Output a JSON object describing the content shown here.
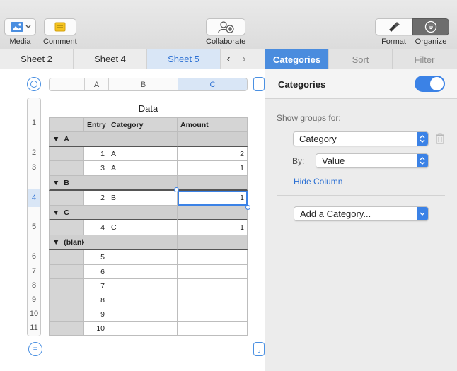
{
  "toolbar": {
    "media_label": "Media",
    "comment_label": "Comment",
    "collaborate_label": "Collaborate",
    "format_label": "Format",
    "organize_label": "Organize"
  },
  "sheet_tabs": [
    "Sheet 2",
    "Sheet 4",
    "Sheet 5"
  ],
  "active_sheet": "Sheet 5",
  "table": {
    "title": "Data",
    "column_letters": [
      "A",
      "B",
      "C"
    ],
    "selected_column": "C",
    "row_numbers": [
      "1",
      "2",
      "3",
      "4",
      "5",
      "6",
      "7",
      "8",
      "9",
      "10",
      "11"
    ],
    "selected_row": "4",
    "headers": [
      "Entry",
      "Category",
      "Amount"
    ],
    "groups": [
      {
        "label": "A",
        "rows": [
          {
            "entry": "1",
            "category": "A",
            "amount": "2"
          },
          {
            "entry": "3",
            "category": "A",
            "amount": "1"
          }
        ]
      },
      {
        "label": "B",
        "rows": [
          {
            "entry": "2",
            "category": "B",
            "amount": "1"
          }
        ]
      },
      {
        "label": "C",
        "rows": [
          {
            "entry": "4",
            "category": "C",
            "amount": "1"
          }
        ]
      },
      {
        "label": "(blank)",
        "rows": [
          {
            "entry": "5",
            "category": "",
            "amount": ""
          },
          {
            "entry": "6",
            "category": "",
            "amount": ""
          },
          {
            "entry": "7",
            "category": "",
            "amount": ""
          },
          {
            "entry": "8",
            "category": "",
            "amount": ""
          },
          {
            "entry": "9",
            "category": "",
            "amount": ""
          },
          {
            "entry": "10",
            "category": "",
            "amount": ""
          }
        ]
      }
    ],
    "group_marker": "▼"
  },
  "inspector": {
    "tabs": [
      "Categories",
      "Sort",
      "Filter"
    ],
    "active_tab": "Categories",
    "section_title": "Categories",
    "toggle_on": true,
    "show_groups_label": "Show groups for:",
    "group_field": "Category",
    "by_label": "By:",
    "by_value": "Value",
    "hide_column_link": "Hide Column",
    "add_category": "Add a Category..."
  },
  "colors": {
    "accent": "#3b82e6",
    "selection": "#d9e6f6",
    "header_gray": "#d5d5d5",
    "link": "#2a6fd3"
  }
}
